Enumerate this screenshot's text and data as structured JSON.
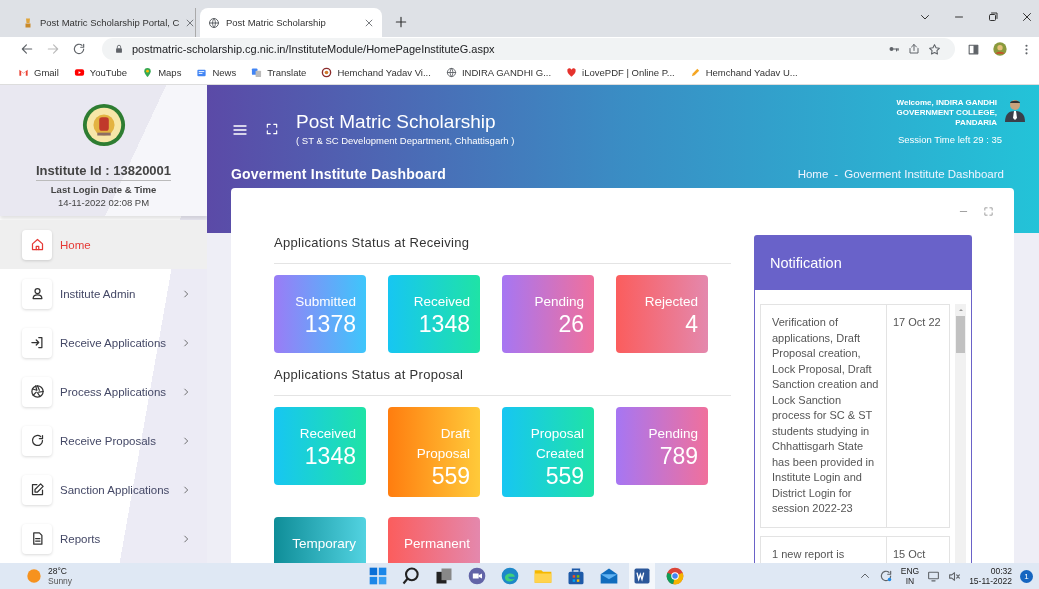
{
  "browser": {
    "tabs": [
      {
        "title": "Post Matric Scholarship Portal, C",
        "selected": false
      },
      {
        "title": "Post Matric Scholarship",
        "selected": true
      }
    ],
    "url": "postmatric-scholarship.cg.nic.in/InstituteModule/HomePageInstituteG.aspx",
    "bookmarks": [
      "Gmail",
      "YouTube",
      "Maps",
      "News",
      "Translate",
      "Hemchand Yadav Vi...",
      "INDIRA GANDHI G...",
      "iLovePDF | Online P...",
      "Hemchand Yadav U..."
    ]
  },
  "sidebar": {
    "institute_id": "Institute Id : 13820001",
    "last_login_label": "Last Login Date & Time",
    "last_login": "14-11-2022 02:08 PM",
    "items": [
      {
        "label": "Home",
        "selected": true,
        "arrow": false
      },
      {
        "label": "Institute Admin",
        "selected": false,
        "arrow": true
      },
      {
        "label": "Receive Applications",
        "selected": false,
        "arrow": true
      },
      {
        "label": "Process Applications",
        "selected": false,
        "arrow": true
      },
      {
        "label": "Receive Proposals",
        "selected": false,
        "arrow": true
      },
      {
        "label": "Sanction Applications",
        "selected": false,
        "arrow": true
      },
      {
        "label": "Reports",
        "selected": false,
        "arrow": true
      }
    ]
  },
  "header": {
    "title": "Post Matric Scholarship",
    "subtitle": "( ST & SC Development Department, Chhattisgarh )",
    "welcome": "Welcome, INDIRA GANDHI GOVERNMENT COLLEGE, PANDARIA",
    "session": "Session Time left 29 : 35"
  },
  "page_title": "Goverment Institute Dashboard",
  "breadcrumb": {
    "home": "Home",
    "separator": "-",
    "current": "Goverment Institute Dashboard"
  },
  "sections": [
    {
      "title": "Applications Status at Receiving",
      "cards": [
        {
          "label": "Submitted",
          "value": "1378",
          "kind": "indigo"
        },
        {
          "label": "Received",
          "value": "1348",
          "kind": "aqua"
        },
        {
          "label": "Pending",
          "value": "26",
          "kind": "orchid"
        },
        {
          "label": "Rejected",
          "value": "4",
          "kind": "coral"
        }
      ]
    },
    {
      "title": "Applications Status at Proposal",
      "cards": [
        {
          "label": "Received",
          "value": "1348",
          "kind": "aqua"
        },
        {
          "label": "Draft Proposal",
          "value": "559",
          "kind": "amber"
        },
        {
          "label": "Proposal Created",
          "value": "559",
          "kind": "aqua"
        },
        {
          "label": "Pending",
          "value": "789",
          "kind": "orchid"
        },
        {
          "label": "Temporary",
          "kind": "teal"
        },
        {
          "label": "Permanent",
          "kind": "coral"
        }
      ]
    }
  ],
  "notification": {
    "title": "Notification",
    "rows": [
      {
        "text": "Verification of applications, Draft Proposal creation, Lock Proposal, Draft Sanction creation and Lock Sanction process for SC & ST students studying in Chhattisgarh State has been provided in Institute Login and District Login for session 2022-23",
        "date": "17 Oct 22"
      },
      {
        "text": "1 new report is",
        "date": "15 Oct"
      }
    ]
  },
  "taskbar": {
    "temperature": "28°C",
    "weather": "Sunny",
    "language": "ENG",
    "region": "IN",
    "time": "00:32",
    "date": "15-11-2022",
    "badge": "1"
  }
}
